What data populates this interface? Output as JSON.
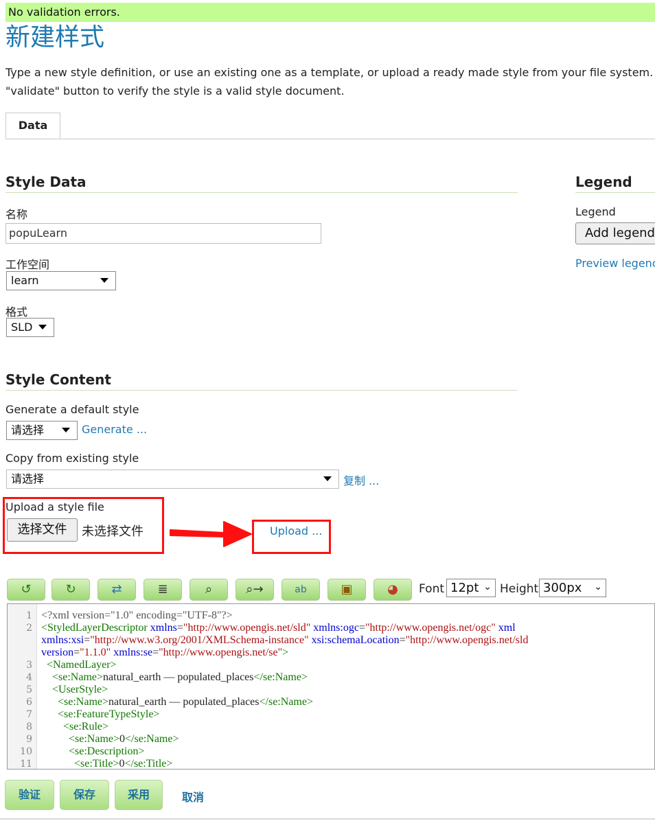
{
  "status_message": "No validation errors.",
  "page_title": "新建样式",
  "intro": {
    "line1": "Type a new style definition, or use an existing one as a template, or upload a ready made style from your file system. T",
    "line2": "\"validate\" button to verify the style is a valid style document."
  },
  "tabs": [
    {
      "label": "Data",
      "active": true
    }
  ],
  "style_data": {
    "heading": "Style Data",
    "name_label": "名称",
    "name_value": "popuLearn",
    "workspace_label": "工作空间",
    "workspace_value": "learn",
    "format_label": "格式",
    "format_value": "SLD"
  },
  "legend": {
    "heading": "Legend",
    "label": "Legend",
    "add_button": "Add legend",
    "preview_link": "Preview legenc"
  },
  "style_content": {
    "heading": "Style Content",
    "generate_label": "Generate a default style",
    "generate_select": "请选择",
    "generate_link": "Generate ...",
    "copy_label": "Copy from existing style",
    "copy_select": "请选择",
    "copy_link": "复制 ...",
    "upload_label": "Upload a style file",
    "choose_file_button": "选择文件",
    "no_file_text": "未选择文件",
    "upload_link": "Upload ..."
  },
  "editor_toolbar": {
    "icons": [
      "undo-icon",
      "redo-icon",
      "search-replace-icon",
      "reindent-icon",
      "find-icon",
      "find-next-icon",
      "format-icon",
      "image-icon",
      "palette-icon"
    ],
    "font_label": "Font",
    "font_value": "12pt",
    "height_label": "Height",
    "height_value": "300px"
  },
  "editor": {
    "line_numbers": [
      "1",
      "2",
      "",
      "",
      "3",
      "4",
      "5",
      "6",
      "7",
      "8",
      "9",
      "10",
      "11"
    ]
  },
  "actions": {
    "validate": "验证",
    "save": "保存",
    "apply": "采用",
    "cancel": "取消"
  },
  "colors": {
    "accent": "#1e7ab2",
    "status_bg": "#c2fc93",
    "highlight": "#ff1010",
    "button_green": "#a9de82"
  }
}
